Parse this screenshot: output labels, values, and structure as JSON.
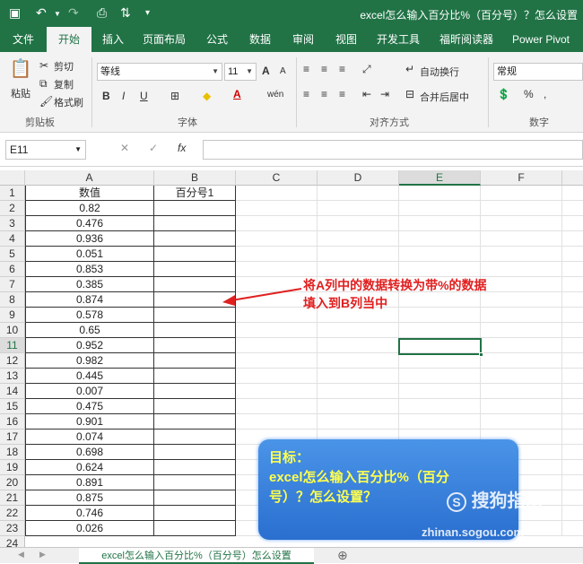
{
  "window": {
    "title": "excel怎么输入百分比%（百分号）？怎么设置"
  },
  "quick_access": {
    "save_icon": "floppy-icon",
    "undo_icon": "undo-icon",
    "redo_icon": "redo-icon",
    "preview_icon": "print-preview-icon",
    "sort_icon": "sort-icon"
  },
  "tabs": [
    "文件",
    "开始",
    "插入",
    "页面布局",
    "公式",
    "数据",
    "审阅",
    "视图",
    "开发工具",
    "福昕阅读器",
    "Power Pivot"
  ],
  "active_tab": "开始",
  "ribbon": {
    "clipboard": {
      "paste": "粘贴",
      "cut": "剪切",
      "copy": "复制",
      "format_painter": "格式刷",
      "label": "剪贴板"
    },
    "font": {
      "name": "等线",
      "size": "11",
      "grow": "A",
      "shrink": "A",
      "bold": "B",
      "italic": "I",
      "underline": "U",
      "label": "字体"
    },
    "alignment": {
      "wrap": "自动换行",
      "merge": "合并后居中",
      "label": "对齐方式"
    },
    "number": {
      "format": "常规",
      "percent": "%",
      "comma": ",",
      "label": "数字"
    }
  },
  "formula_bar": {
    "name_box": "E11",
    "cancel": "✕",
    "enter": "✓",
    "fx": "fx",
    "value": ""
  },
  "columns": [
    "A",
    "B",
    "C",
    "D",
    "E",
    "F"
  ],
  "selected_cell": "E11",
  "header_row": [
    "数值",
    "百分号1"
  ],
  "rows": [
    "0.82",
    "0.476",
    "0.936",
    "0.051",
    "0.853",
    "0.385",
    "0.874",
    "0.578",
    "0.65",
    "0.952",
    "0.982",
    "0.445",
    "0.007",
    "0.475",
    "0.901",
    "0.074",
    "0.698",
    "0.624",
    "0.891",
    "0.875",
    "0.746",
    "0.026"
  ],
  "annotation": {
    "line1": "将A列中的数据转换为带%的数据",
    "line2": "填入到B列当中",
    "color": "#e02020"
  },
  "goal_box": {
    "line1": "目标：",
    "line2": "excel怎么输入百分比%（百分",
    "line3": "号）？怎么设置？"
  },
  "watermark": {
    "brand": "搜狗指南",
    "url": "zhinan.sogou.com"
  },
  "sheet_tab": "excel怎么输入百分比%（百分号）怎么设置",
  "colors": {
    "accent": "#217346",
    "bubble": "#2a6fcf",
    "bubble_text": "#ffff4d"
  }
}
